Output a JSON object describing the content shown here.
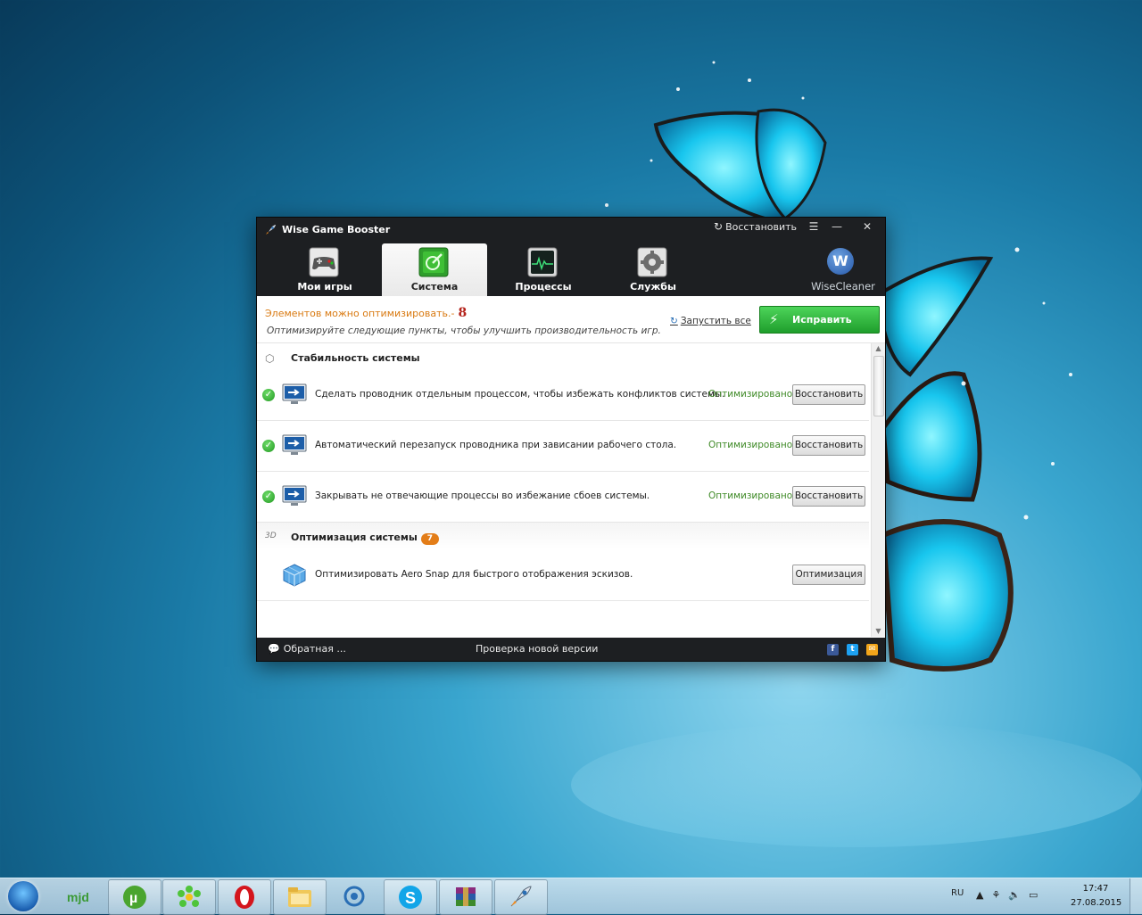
{
  "window": {
    "title": "Wise Game Booster",
    "restore_label": "Восстановить",
    "controls": [
      "menu",
      "minimize",
      "close"
    ]
  },
  "nav": {
    "tabs": [
      {
        "label": "Мои игры",
        "icon": "gamepad-icon"
      },
      {
        "label": "Система",
        "icon": "system-optimize-icon",
        "active": true
      },
      {
        "label": "Процессы",
        "icon": "heartbeat-monitor-icon"
      },
      {
        "label": "Службы",
        "icon": "gear-icon"
      }
    ],
    "wisecleaner_label": "WiseCleaner",
    "wisecleaner_letter": "W"
  },
  "header": {
    "count_text": "Элементов можно оптимизировать.-",
    "count_value": "8",
    "hint": "Оптимизируйте следующие пункты, чтобы улучшить производительность игр.",
    "run_all": "Запустить все",
    "fix_button": "Исправить"
  },
  "sections": [
    {
      "title": "Стабильность системы",
      "items": [
        {
          "text": "Сделать проводник отдельным процессом, чтобы избежать конфликтов системы.",
          "status": "Оптимизировано",
          "button": "Восстановить"
        },
        {
          "text": "Автоматический перезапуск проводника при зависании рабочего стола.",
          "status": "Оптимизировано",
          "button": "Восстановить"
        },
        {
          "text": "Закрывать не отвечающие процессы во избежание сбоев системы.",
          "status": "Оптимизировано",
          "button": "Восстановить"
        }
      ]
    },
    {
      "title": "Оптимизация системы",
      "badge": "7",
      "items": [
        {
          "text": "Оптимизировать Aero Snap для быстрого отображения эскизов.",
          "status": "",
          "button": "Оптимизация"
        }
      ]
    }
  ],
  "footer": {
    "feedback": "Обратная ...",
    "check_update": "Проверка новой версии",
    "social": [
      "facebook-icon",
      "twitter-icon",
      "email-icon"
    ]
  },
  "taskbar": {
    "apps": [
      "mjd-icon",
      "utorrent-icon",
      "icq-icon",
      "opera-icon",
      "explorer-folder-icon",
      "qip-icon",
      "skype-icon",
      "winrar-icon",
      "wise-game-booster-icon"
    ],
    "lang": "RU",
    "time": "17:47",
    "date": "27.08.2015"
  },
  "colors": {
    "accent_green": "#2bb53a",
    "count_orange": "#d97a12",
    "status_green": "#3f8a27",
    "window_dark": "#1d1f22"
  }
}
